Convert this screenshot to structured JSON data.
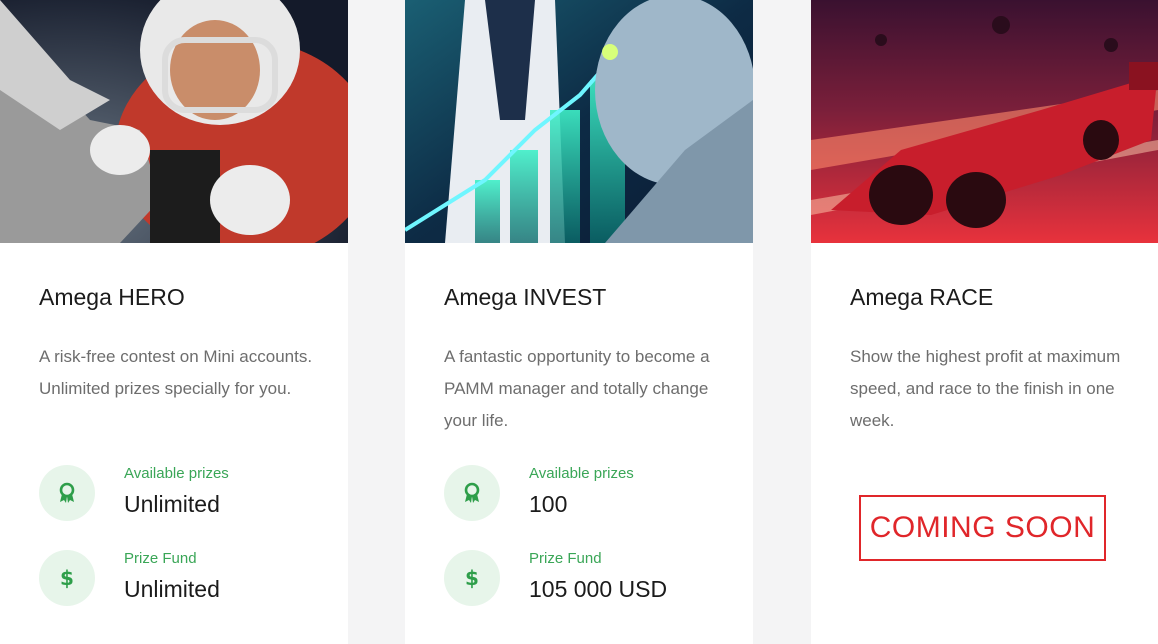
{
  "cards": [
    {
      "title": "Amega HERO",
      "description": "A risk-free contest on Mini accounts. Unlimited prizes specially for you.",
      "stats": [
        {
          "label": "Available prizes",
          "value": "Unlimited",
          "icon": "award-icon"
        },
        {
          "label": "Prize Fund",
          "value": "Unlimited",
          "icon": "dollar-icon"
        }
      ]
    },
    {
      "title": "Amega INVEST",
      "description": "A fantastic opportunity to become a PAMM manager and totally change your life.",
      "stats": [
        {
          "label": "Available prizes",
          "value": "100",
          "icon": "award-icon"
        },
        {
          "label": "Prize Fund",
          "value": "105 000 USD",
          "icon": "dollar-icon"
        }
      ]
    },
    {
      "title": "Amega RACE",
      "description": "Show the highest profit at maximum speed, and race to the finish in one week.",
      "badge": "COMING SOON"
    }
  ],
  "colors": {
    "accent_green": "#3aa657",
    "icon_bg": "#e7f5ea",
    "coming_soon_red": "#e0262a",
    "page_bg": "#f4f4f5"
  }
}
